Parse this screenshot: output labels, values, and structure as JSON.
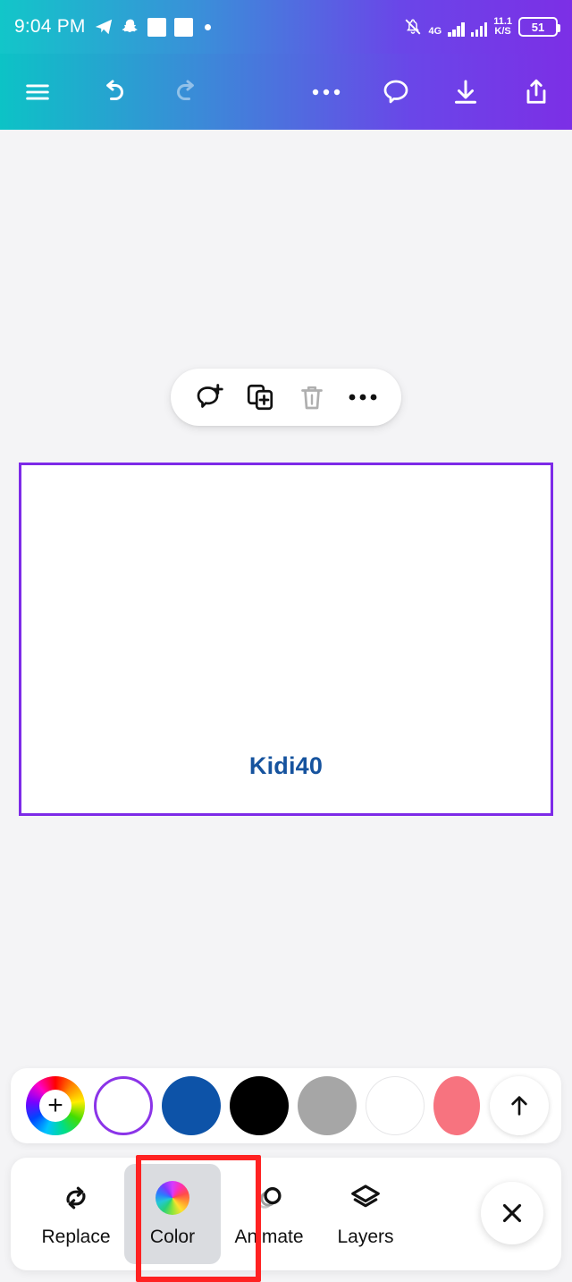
{
  "status_bar": {
    "time": "9:04 PM",
    "icons_left": [
      "telegram-icon",
      "snapchat-icon",
      "white-square-icon",
      "white-square-icon",
      "dot-icon"
    ],
    "notification_state": "silenced",
    "network_type": "4G",
    "data_rate_value": "11.1",
    "data_rate_unit": "K/S",
    "battery_percent": "51"
  },
  "app_toolbar": {
    "left_buttons": [
      {
        "name": "menu-icon",
        "label": "Menu",
        "enabled": true
      },
      {
        "name": "undo-icon",
        "label": "Undo",
        "enabled": true
      },
      {
        "name": "redo-icon",
        "label": "Redo",
        "enabled": false
      }
    ],
    "right_buttons": [
      {
        "name": "more-options-icon",
        "label": "More options",
        "enabled": true
      },
      {
        "name": "comment-icon",
        "label": "Comments",
        "enabled": true
      },
      {
        "name": "download-icon",
        "label": "Download",
        "enabled": true
      },
      {
        "name": "share-icon",
        "label": "Share",
        "enabled": true
      }
    ],
    "gradient_start": "#0cc3c6",
    "gradient_end": "#7c2fe6"
  },
  "element_toolbar": {
    "buttons": [
      {
        "name": "add-comment-icon",
        "label": "Add comment",
        "enabled": true
      },
      {
        "name": "duplicate-icon",
        "label": "Duplicate",
        "enabled": true
      },
      {
        "name": "delete-icon",
        "label": "Delete",
        "enabled": false
      },
      {
        "name": "more-icon",
        "label": "More",
        "enabled": true
      }
    ]
  },
  "slide": {
    "text": "Kidi40",
    "text_color": "#16539e",
    "background": "#ffffff",
    "selection_border_color": "#7d2ae8"
  },
  "color_palette": {
    "add_color_label": "+",
    "swatches": [
      {
        "name": "color-wheel-add",
        "color": "rainbow",
        "selected": false
      },
      {
        "name": "swatch-white-selected",
        "color": "#ffffff",
        "selected": true
      },
      {
        "name": "swatch-blue",
        "color": "#0d53a8",
        "selected": false
      },
      {
        "name": "swatch-black",
        "color": "#000000",
        "selected": false
      },
      {
        "name": "swatch-gray",
        "color": "#a6a6a6",
        "selected": false
      },
      {
        "name": "swatch-white",
        "color": "#ffffff",
        "selected": false
      },
      {
        "name": "swatch-pink",
        "color": "#f7737f",
        "selected": false
      }
    ],
    "expand_label": "Expand colors"
  },
  "bottom_bar": {
    "actions": [
      {
        "name": "replace",
        "label": "Replace",
        "icon": "replace-icon",
        "active": false
      },
      {
        "name": "color",
        "label": "Color",
        "icon": "color-wheel-icon",
        "active": true
      },
      {
        "name": "animate",
        "label": "Animate",
        "icon": "animate-icon",
        "active": false
      },
      {
        "name": "layers",
        "label": "Layers",
        "icon": "layers-icon",
        "active": false
      }
    ],
    "close_label": "Close",
    "highlight_color": "#ff2222",
    "highlighted_action": "Color"
  }
}
